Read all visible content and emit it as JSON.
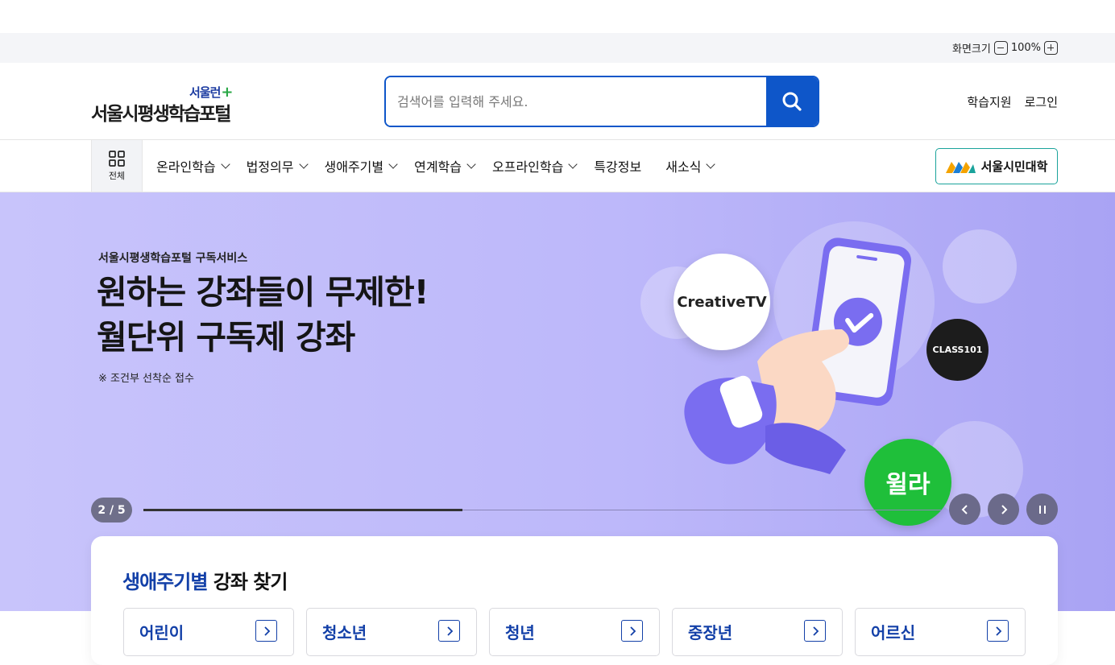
{
  "util": {
    "zoom_label": "화면크기",
    "zoom_value": "100%"
  },
  "header": {
    "logo_sub": "서울런",
    "logo_plus": "+",
    "logo_main": "서울시평생학습포털",
    "search_placeholder": "검색어를 입력해 주세요.",
    "links": [
      "학습지원",
      "로그인"
    ]
  },
  "gnb": {
    "all_label": "전체",
    "menus": [
      {
        "label": "온라인학습",
        "has_dropdown": true
      },
      {
        "label": "법정의무",
        "has_dropdown": true
      },
      {
        "label": "생애주기별",
        "has_dropdown": true
      },
      {
        "label": "연계학습",
        "has_dropdown": true
      },
      {
        "label": "오프라인학습",
        "has_dropdown": true
      },
      {
        "label": "특강정보",
        "has_dropdown": false
      },
      {
        "label": "새소식",
        "has_dropdown": true
      }
    ],
    "univ_button": "서울시민대학"
  },
  "hero": {
    "subtitle": "서울시평생학습포털 구독서비스",
    "title_line1": "원하는 강좌들이 무제한!",
    "title_line2": "월단위 구독제 강좌",
    "note": "※ 조건부 선착순 접수",
    "badges": {
      "creative": "CreativeTV",
      "class101": "CLASS101",
      "willa": "윌라"
    },
    "slide_counter": "2 / 5",
    "progress": 0.4,
    "colors": {
      "bg_start": "#c8c4fb",
      "bg_end": "#a9a3f4",
      "willa": "#1fbf3a"
    }
  },
  "finder": {
    "title_accent": "생애주기별",
    "title_rest": " 강좌 찾기",
    "cards": [
      "어린이",
      "청소년",
      "청년",
      "중장년",
      "어르신"
    ]
  }
}
